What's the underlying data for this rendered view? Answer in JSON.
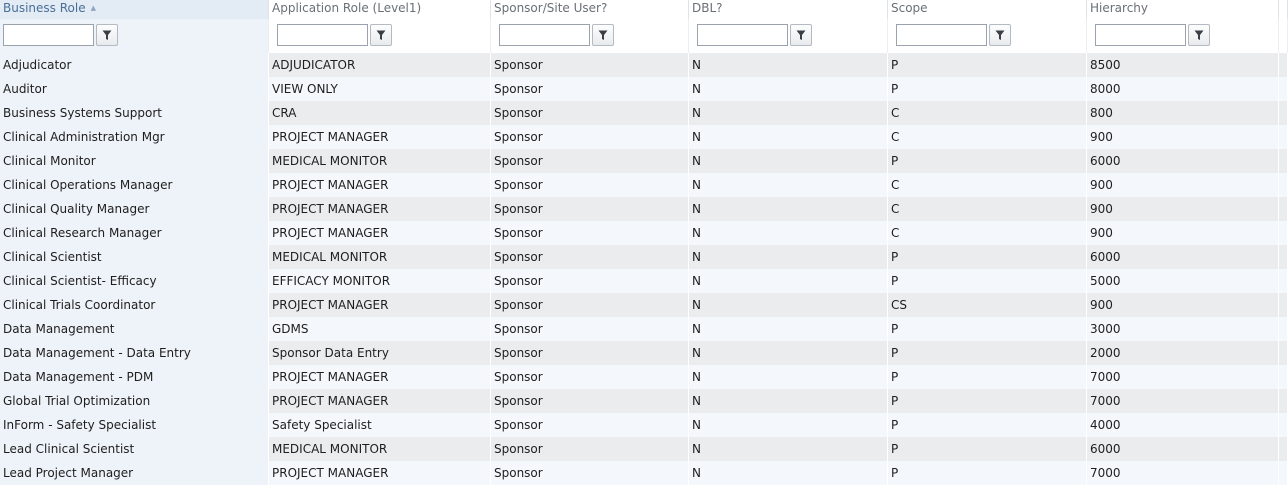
{
  "columns": [
    {
      "label": "Business Role"
    },
    {
      "label": "Application Role (Level1)"
    },
    {
      "label": "Sponsor/Site User?"
    },
    {
      "label": "DBL?"
    },
    {
      "label": "Scope"
    },
    {
      "label": "Hierarchy"
    }
  ],
  "rows": [
    [
      "Adjudicator",
      "ADJUDICATOR",
      "Sponsor",
      "N",
      "P",
      "8500"
    ],
    [
      "Auditor",
      "VIEW ONLY",
      "Sponsor",
      "N",
      "P",
      "8000"
    ],
    [
      "Business Systems Support",
      "CRA",
      "Sponsor",
      "N",
      "C",
      "800"
    ],
    [
      "Clinical Administration Mgr",
      "PROJECT MANAGER",
      "Sponsor",
      "N",
      "C",
      "900"
    ],
    [
      "Clinical Monitor",
      "MEDICAL MONITOR",
      "Sponsor",
      "N",
      "P",
      "6000"
    ],
    [
      "Clinical Operations Manager",
      "PROJECT MANAGER",
      "Sponsor",
      "N",
      "C",
      "900"
    ],
    [
      "Clinical Quality Manager",
      "PROJECT MANAGER",
      "Sponsor",
      "N",
      "C",
      "900"
    ],
    [
      "Clinical Research Manager",
      "PROJECT MANAGER",
      "Sponsor",
      "N",
      "C",
      "900"
    ],
    [
      "Clinical Scientist",
      "MEDICAL MONITOR",
      "Sponsor",
      "N",
      "P",
      "6000"
    ],
    [
      "Clinical Scientist- Efficacy",
      "EFFICACY MONITOR",
      "Sponsor",
      "N",
      "P",
      "5000"
    ],
    [
      "Clinical Trials Coordinator",
      "PROJECT MANAGER",
      "Sponsor",
      "N",
      "CS",
      "900"
    ],
    [
      "Data Management",
      "GDMS",
      "Sponsor",
      "N",
      "P",
      "3000"
    ],
    [
      "Data Management - Data Entry",
      "Sponsor Data Entry",
      "Sponsor",
      "N",
      "P",
      "2000"
    ],
    [
      "Data Management - PDM",
      "PROJECT MANAGER",
      "Sponsor",
      "N",
      "P",
      "7000"
    ],
    [
      "Global Trial Optimization",
      "PROJECT MANAGER",
      "Sponsor",
      "N",
      "P",
      "7000"
    ],
    [
      "InForm - Safety Specialist",
      "Safety Specialist",
      "Sponsor",
      "N",
      "P",
      "4000"
    ],
    [
      "Lead Clinical Scientist",
      "MEDICAL MONITOR",
      "Sponsor",
      "N",
      "P",
      "6000"
    ],
    [
      "Lead Project Manager",
      "PROJECT MANAGER",
      "Sponsor",
      "N",
      "P",
      "7000"
    ]
  ],
  "sort": {
    "column": "Business Role",
    "direction": "ascending"
  }
}
